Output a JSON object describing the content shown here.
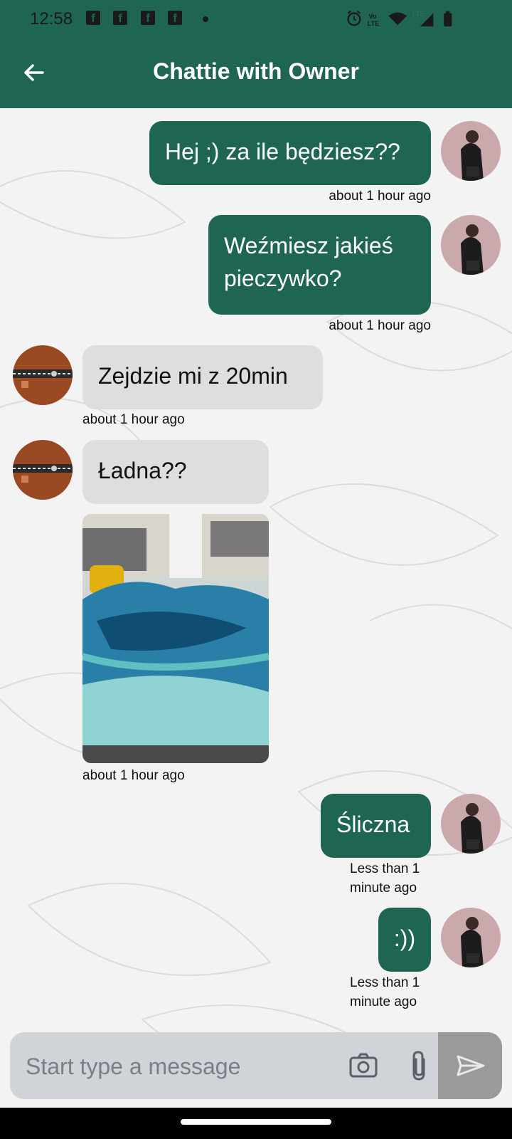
{
  "status_bar": {
    "time": "12:58",
    "notification_icons": [
      "facebook-icon",
      "facebook-icon",
      "facebook-icon",
      "facebook-icon"
    ],
    "network_label": "LTE",
    "volte_label": "Vo\nLTE"
  },
  "header": {
    "title": "Chattie with Owner"
  },
  "messages": [
    {
      "side": "out",
      "text": "Hej ;) za ile będziesz??",
      "time": "about 1 hour ago"
    },
    {
      "side": "out",
      "text": "Weźmiesz jakieś pieczywko?",
      "time": "about 1 hour ago"
    },
    {
      "side": "in",
      "text": "Zejdzie mi z 20min",
      "time": "about 1 hour ago"
    },
    {
      "side": "in",
      "text": "Ładna??",
      "time": ""
    },
    {
      "side": "in",
      "type": "image",
      "time": "about 1 hour ago"
    },
    {
      "side": "out",
      "text": "Śliczna",
      "time": "Less than 1 minute ago"
    },
    {
      "side": "out",
      "text": ":))",
      "time": "Less than 1 minute ago"
    }
  ],
  "composer": {
    "placeholder": "Start type a message"
  },
  "colors": {
    "accent": "#1e6653",
    "incoming_bubble": "#dedede",
    "input_bar": "#d0d3d8",
    "send_button": "#9a9a9a"
  }
}
